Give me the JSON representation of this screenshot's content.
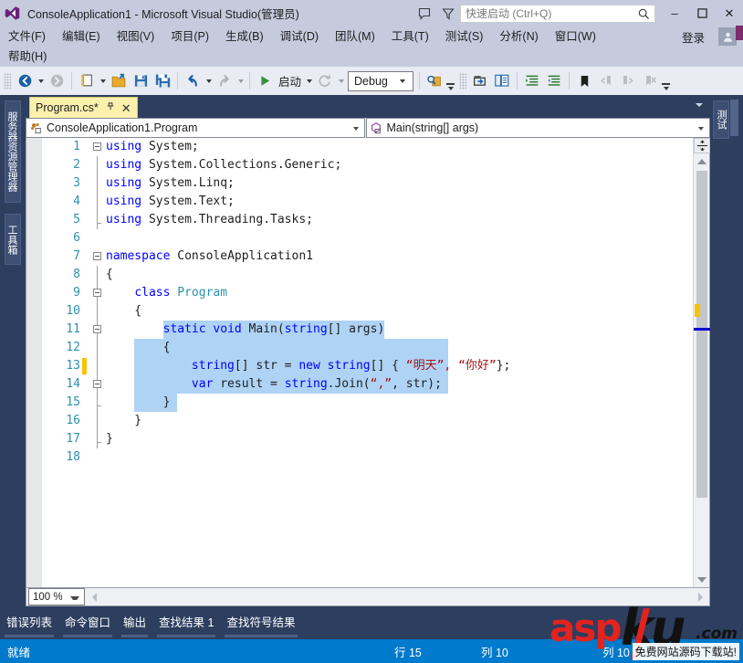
{
  "titlebar": {
    "app_title": "ConsoleApplication1 - Microsoft Visual Studio(管理员)",
    "logo_name": "visual-studio-logo",
    "feedback_icon": "feedback-bubble-icon",
    "filter_icon": "funnel-filter-icon",
    "quick_launch_placeholder": "快速启动 (Ctrl+Q)",
    "quick_launch_value": "",
    "minimize_label": "–",
    "maximize_label": "❐",
    "close_label": "✕"
  },
  "menubar": {
    "items": [
      {
        "text": "文件(F)",
        "mnemonic": "F"
      },
      {
        "text": "编辑(E)",
        "mnemonic": "E"
      },
      {
        "text": "视图(V)",
        "mnemonic": "V"
      },
      {
        "text": "项目(P)",
        "mnemonic": "P"
      },
      {
        "text": "生成(B)",
        "mnemonic": "B"
      },
      {
        "text": "调试(D)",
        "mnemonic": "D"
      },
      {
        "text": "团队(M)",
        "mnemonic": "M"
      },
      {
        "text": "工具(T)",
        "mnemonic": "T"
      },
      {
        "text": "测试(S)",
        "mnemonic": "S"
      },
      {
        "text": "分析(N)",
        "mnemonic": "N"
      },
      {
        "text": "窗口(W)",
        "mnemonic": "W"
      }
    ],
    "second_row": [
      {
        "text": "帮助(H)",
        "mnemonic": "H"
      }
    ],
    "signin_label": "登录",
    "account_icon": "account-person-icon"
  },
  "toolbar": {
    "back_icon": "navigate-back-icon",
    "forward_icon": "navigate-forward-icon",
    "new_project_icon": "new-project-icon",
    "open_file_icon": "open-file-folder-icon",
    "save_icon": "save-icon",
    "save_all_icon": "save-all-icon",
    "undo_icon": "undo-arrow-icon",
    "redo_icon": "redo-arrow-icon",
    "start_icon": "start-debug-play-icon",
    "start_label": "启动",
    "restart_icon": "restart-circle-icon",
    "config_value": "Debug",
    "find_icon": "find-in-files-icon",
    "step_icon": "step-into-icon",
    "compare_icon": "compare-files-icon",
    "indent_icon": "increase-indent-icon",
    "outdent_icon": "decrease-indent-icon",
    "bookmark_icon": "bookmark-icon",
    "prev_bookmark_icon": "previous-bookmark-icon",
    "next_bookmark_icon": "next-bookmark-icon",
    "clear_bookmark_icon": "clear-bookmarks-icon",
    "overflow_icon": "toolbar-overflow-icon"
  },
  "left_rail": {
    "items": [
      {
        "label": "服务器资源管理器",
        "name": "sidebar-item-server-explorer"
      },
      {
        "label": "工具箱",
        "name": "sidebar-item-toolbox"
      }
    ]
  },
  "right_rail": {
    "items": [
      {
        "label": "测试",
        "name": "sidebar-item-test-explorer"
      }
    ]
  },
  "document": {
    "tab_label": "Program.cs*",
    "pin_icon": "pin-icon",
    "close_icon": "close-tab-icon",
    "tabstrip_menu_icon": "tab-list-chevron-icon",
    "nav_class_icon": "class-member-icon",
    "nav_class_value": "ConsoleApplication1.Program",
    "nav_member_icon": "method-member-icon",
    "nav_member_value": "Main(string[] args)"
  },
  "editor": {
    "zoom_value": "100 %",
    "split_icon": "split-view-icon",
    "scroll_up_icon": "scroll-up-arrow-icon",
    "scroll_down_icon": "scroll-down-arrow-icon",
    "hscroll_left_icon": "scroll-left-arrow-icon",
    "hscroll_right_icon": "scroll-right-arrow-icon",
    "lines": [
      {
        "n": "1",
        "fold": "start",
        "guide": false,
        "text": "using System;",
        "tokens": [
          {
            "t": "using ",
            "c": "kw"
          },
          {
            "t": "System;",
            "c": ""
          }
        ]
      },
      {
        "n": "2",
        "fold": "none",
        "guide": true,
        "text": "using System.Collections.Generic;",
        "tokens": [
          {
            "t": "using ",
            "c": "kw"
          },
          {
            "t": "System.Collections.Generic;",
            "c": ""
          }
        ]
      },
      {
        "n": "3",
        "fold": "none",
        "guide": true,
        "text": "using System.Linq;",
        "tokens": [
          {
            "t": "using ",
            "c": "kw"
          },
          {
            "t": "System.Linq;",
            "c": ""
          }
        ]
      },
      {
        "n": "4",
        "fold": "none",
        "guide": true,
        "text": "using System.Text;",
        "tokens": [
          {
            "t": "using ",
            "c": "kw"
          },
          {
            "t": "System.Text;",
            "c": ""
          }
        ]
      },
      {
        "n": "5",
        "fold": "end",
        "guide": true,
        "text": "using System.Threading.Tasks;",
        "tokens": [
          {
            "t": "using ",
            "c": "kw"
          },
          {
            "t": "System.Threading.Tasks;",
            "c": ""
          }
        ]
      },
      {
        "n": "6",
        "fold": "none",
        "guide": false,
        "text": "",
        "tokens": []
      },
      {
        "n": "7",
        "fold": "start",
        "guide": false,
        "text": "namespace ConsoleApplication1",
        "tokens": [
          {
            "t": "namespace ",
            "c": "kw"
          },
          {
            "t": "ConsoleApplication1",
            "c": ""
          }
        ]
      },
      {
        "n": "8",
        "fold": "none",
        "guide": true,
        "text": "{",
        "tokens": [
          {
            "t": "{",
            "c": ""
          }
        ]
      },
      {
        "n": "9",
        "fold": "start",
        "guide": true,
        "text": "    class Program",
        "tokens": [
          {
            "t": "    ",
            "c": ""
          },
          {
            "t": "class ",
            "c": "kw"
          },
          {
            "t": "Program",
            "c": "typ"
          }
        ]
      },
      {
        "n": "10",
        "fold": "none",
        "guide": true,
        "text": "    {",
        "tokens": [
          {
            "t": "    {",
            "c": ""
          }
        ]
      },
      {
        "n": "11",
        "fold": "start",
        "guide": true,
        "text": "        static void Main(string[] args)",
        "tokens": [
          {
            "t": "        ",
            "c": ""
          },
          {
            "t": "static void ",
            "c": "kw"
          },
          {
            "t": "Main(",
            "c": ""
          },
          {
            "t": "string",
            "c": "kw"
          },
          {
            "t": "[] args)",
            "c": ""
          }
        ]
      },
      {
        "n": "12",
        "fold": "none",
        "guide": true,
        "text": "        {",
        "tokens": [
          {
            "t": "        {",
            "c": ""
          }
        ]
      },
      {
        "n": "13",
        "fold": "none",
        "guide": true,
        "text": "            string[] str = new string[] { “明天”, “你好”};",
        "tokens": [
          {
            "t": "            ",
            "c": ""
          },
          {
            "t": "string",
            "c": "kw"
          },
          {
            "t": "[] str = ",
            "c": ""
          },
          {
            "t": "new string",
            "c": "kw"
          },
          {
            "t": "[] { ",
            "c": ""
          },
          {
            "t": "“明天”, “你好”",
            "c": "str"
          },
          {
            "t": "};",
            "c": ""
          }
        ]
      },
      {
        "n": "14",
        "fold": "start",
        "guide": true,
        "text": "            var result = string.Join(“,”, str);",
        "tokens": [
          {
            "t": "            ",
            "c": ""
          },
          {
            "t": "var",
            "c": "kw"
          },
          {
            "t": " result = ",
            "c": ""
          },
          {
            "t": "string",
            "c": "kw"
          },
          {
            "t": ".Join(",
            "c": ""
          },
          {
            "t": "“,”",
            "c": "str"
          },
          {
            "t": ", str);",
            "c": ""
          }
        ]
      },
      {
        "n": "15",
        "fold": "end",
        "guide": true,
        "text": "        }",
        "tokens": [
          {
            "t": "        }",
            "c": ""
          }
        ]
      },
      {
        "n": "16",
        "fold": "none",
        "guide": true,
        "text": "    }",
        "tokens": [
          {
            "t": "    }",
            "c": ""
          }
        ]
      },
      {
        "n": "17",
        "fold": "end",
        "guide": true,
        "text": "}",
        "tokens": [
          {
            "t": "}",
            "c": ""
          }
        ]
      },
      {
        "n": "18",
        "fold": "none",
        "guide": false,
        "text": "",
        "tokens": []
      }
    ],
    "caret_line": "13",
    "selection_lines": [
      "11",
      "12",
      "13",
      "14",
      "15"
    ]
  },
  "panel_tabs": {
    "items": [
      {
        "label": "错误列表",
        "name": "panel-tab-error-list"
      },
      {
        "label": "命令窗口",
        "name": "panel-tab-command-window"
      },
      {
        "label": "输出",
        "name": "panel-tab-output"
      },
      {
        "label": "查找结果 1",
        "name": "panel-tab-find-results-1"
      },
      {
        "label": "查找符号结果",
        "name": "panel-tab-find-symbol-results"
      }
    ]
  },
  "statusbar": {
    "status": "就绪",
    "line_label": "行 15",
    "col_label": "列 10",
    "col_label_2": "列 10"
  },
  "watermark": {
    "asp": "asp",
    "ku": "ku",
    "com": ".com",
    "sub": "免费网站源码下载站!"
  },
  "colors": {
    "accent_blue": "#007acc",
    "chrome_dark": "#2d3e5f",
    "titlebar": "#c5cbdd",
    "toolbar": "#e9ecf3",
    "tab_active": "#fcf0ad",
    "selection": "#aed3f5",
    "keyword": "#0000ff",
    "type": "#2b91af",
    "string": "#a31515",
    "linenumber": "#2b91af",
    "caret_marker": "#f7c400",
    "watermark_red": "#e3231f"
  }
}
